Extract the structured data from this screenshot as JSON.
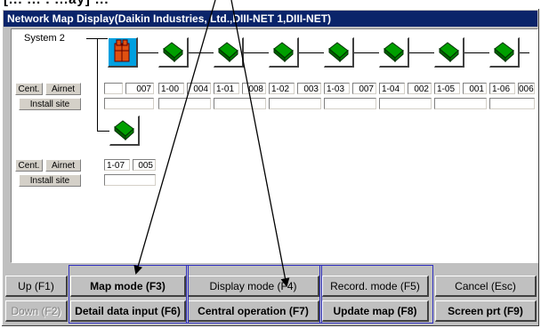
{
  "top_text": "[... ... . ...ay] ...",
  "window": {
    "title": "Network Map Display(Daikin Industries, Ltd.,DIII-NET 1,DIII-NET)"
  },
  "map": {
    "system_label": "System 2",
    "row1": {
      "cent": "Cent.",
      "airnet": "Airnet",
      "install_site": "Install site",
      "units": [
        {
          "addr": "",
          "num": "007"
        },
        {
          "addr": "1-00",
          "num": "004"
        },
        {
          "addr": "1-01",
          "num": "008"
        },
        {
          "addr": "1-02",
          "num": "003"
        },
        {
          "addr": "1-03",
          "num": "007"
        },
        {
          "addr": "1-04",
          "num": "002"
        },
        {
          "addr": "1-05",
          "num": "001"
        },
        {
          "addr": "1-06",
          "num": "006"
        }
      ]
    },
    "row2": {
      "cent": "Cent.",
      "airnet": "Airnet",
      "install_site": "Install site",
      "unit": {
        "addr": "1-07",
        "num": "005"
      }
    }
  },
  "buttons": {
    "up": "Up (F1)",
    "map_mode": "Map mode (F3)",
    "display_mode": "Display mode (F4)",
    "record_mode": "Record. mode (F5)",
    "cancel": "Cancel (Esc)",
    "down": "Down (F2)",
    "detail_input": "Detail data input (F6)",
    "central_operation": "Central operation (F7)",
    "update_map": "Update map (F8)",
    "screen_prt": "Screen prt (F9)"
  },
  "colors": {
    "title_bar": "#0a246a",
    "group_border": "#3030c0",
    "indoor_unit": "#00a000",
    "central_unit": "#00a0e0"
  }
}
